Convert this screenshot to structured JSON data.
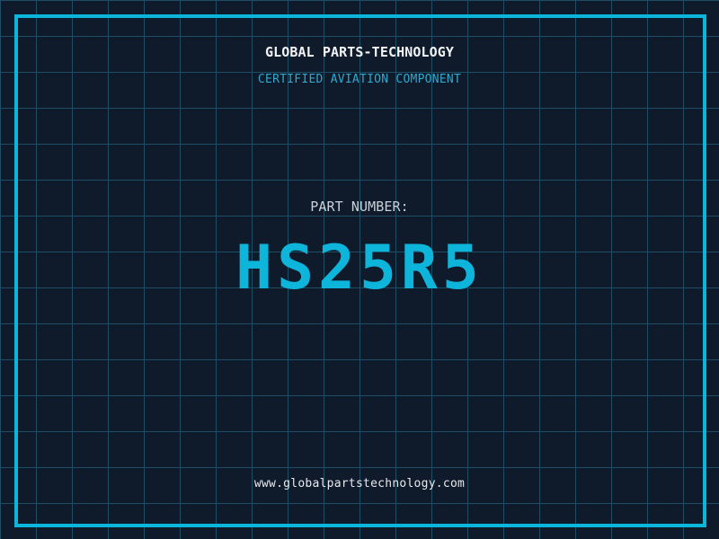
{
  "header": {
    "title": "GLOBAL PARTS-TECHNOLOGY",
    "subtitle": "CERTIFIED AVIATION COMPONENT"
  },
  "part": {
    "label": "PART NUMBER:",
    "number": "HS25R5"
  },
  "footer": {
    "website": "www.globalpartstechnology.com"
  },
  "colors": {
    "background": "#0f1a2b",
    "grid_line": "#1d4e63",
    "frame_cyan": "#0cb5da",
    "part_number_cyan": "#0db5da",
    "subtitle_cyan": "#2fa9ce",
    "title_white": "#f2f5f7",
    "label_gray": "#c9d2da",
    "website_white": "#e8ebee"
  },
  "layout_meta": {
    "grid_spacing_px": "40"
  }
}
